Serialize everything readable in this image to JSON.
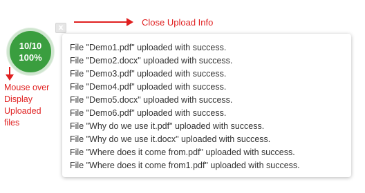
{
  "badge": {
    "count": "10/10",
    "percent": "100%"
  },
  "close_button": {
    "glyph": "x"
  },
  "annotations": {
    "close_info": "Close Upload Info",
    "mouse_over": [
      "Mouse over",
      "Display",
      "Uploaded",
      "files"
    ]
  },
  "uploads": [
    "File \"Demo1.pdf\" uploaded with success.",
    "File \"Demo2.docx\" uploaded with success.",
    "File \"Demo3.pdf\" uploaded with success.",
    "File \"Demo4.pdf\" uploaded with success.",
    "File \"Demo5.docx\" uploaded with success.",
    "File \"Demo6.pdf\" uploaded with success.",
    "File \"Why do we use it.pdf\" uploaded with success.",
    "File \"Why do we use it.docx\" uploaded with success.",
    "File \"Where does it come from.pdf\" uploaded with success.",
    "File \"Where does it come from1.pdf\" uploaded with success."
  ],
  "colors": {
    "badge": "#3a9e3f",
    "annotation": "#e01f1f"
  }
}
